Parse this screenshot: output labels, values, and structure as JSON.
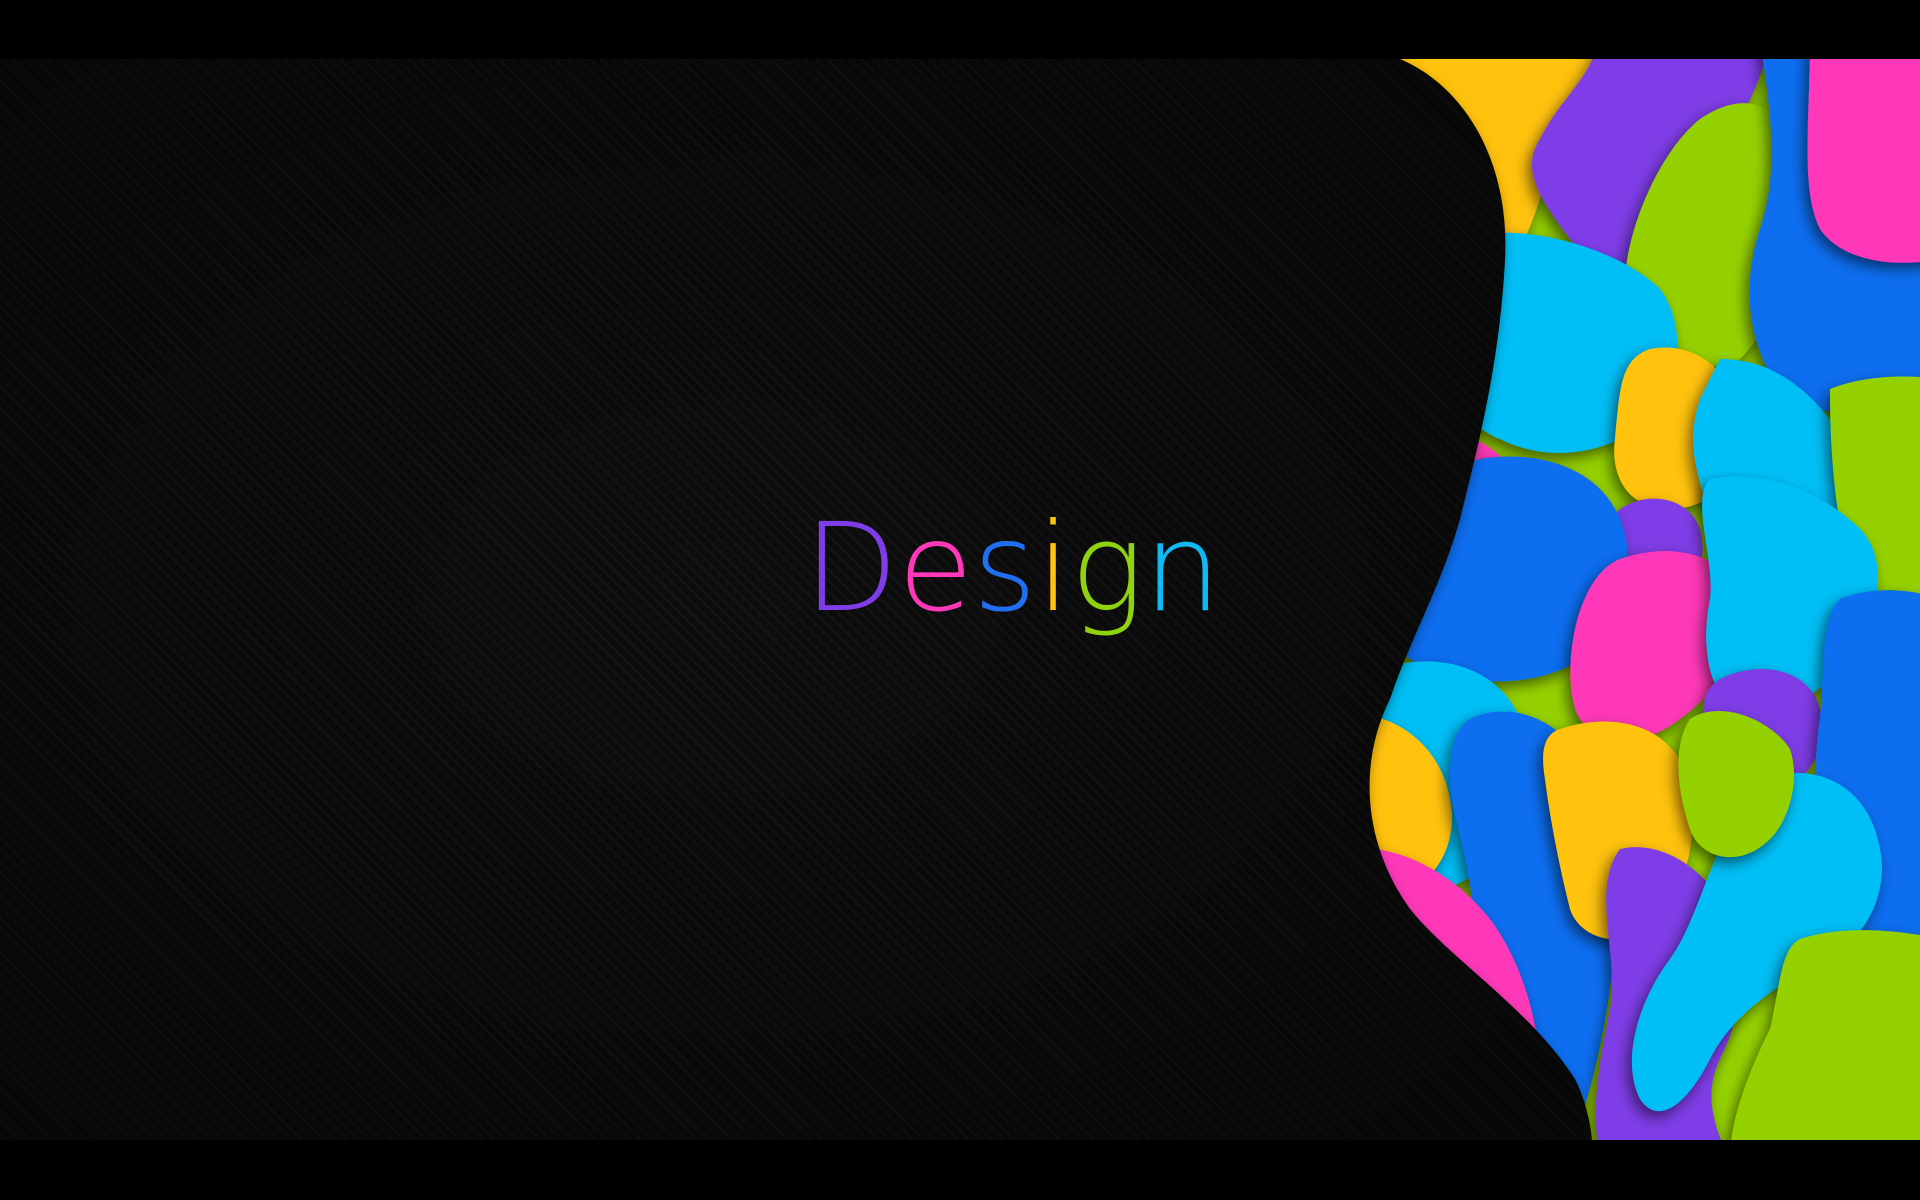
{
  "headline": {
    "letters": [
      "D",
      "e",
      "s",
      "i",
      "g",
      "n"
    ],
    "colors": [
      "#7e3de6",
      "#ff38b9",
      "#1f6ff0",
      "#ffc20e",
      "#8fd30f",
      "#10b9f2"
    ]
  },
  "palette": {
    "background": "#0d0d0d",
    "stripe": "#1a1a1a",
    "yellow": "#ffc20e",
    "purple": "#7e3de6",
    "green": "#95d100",
    "pink": "#ff38b9",
    "cyan": "#00bff6",
    "blue": "#0d6ef0"
  }
}
